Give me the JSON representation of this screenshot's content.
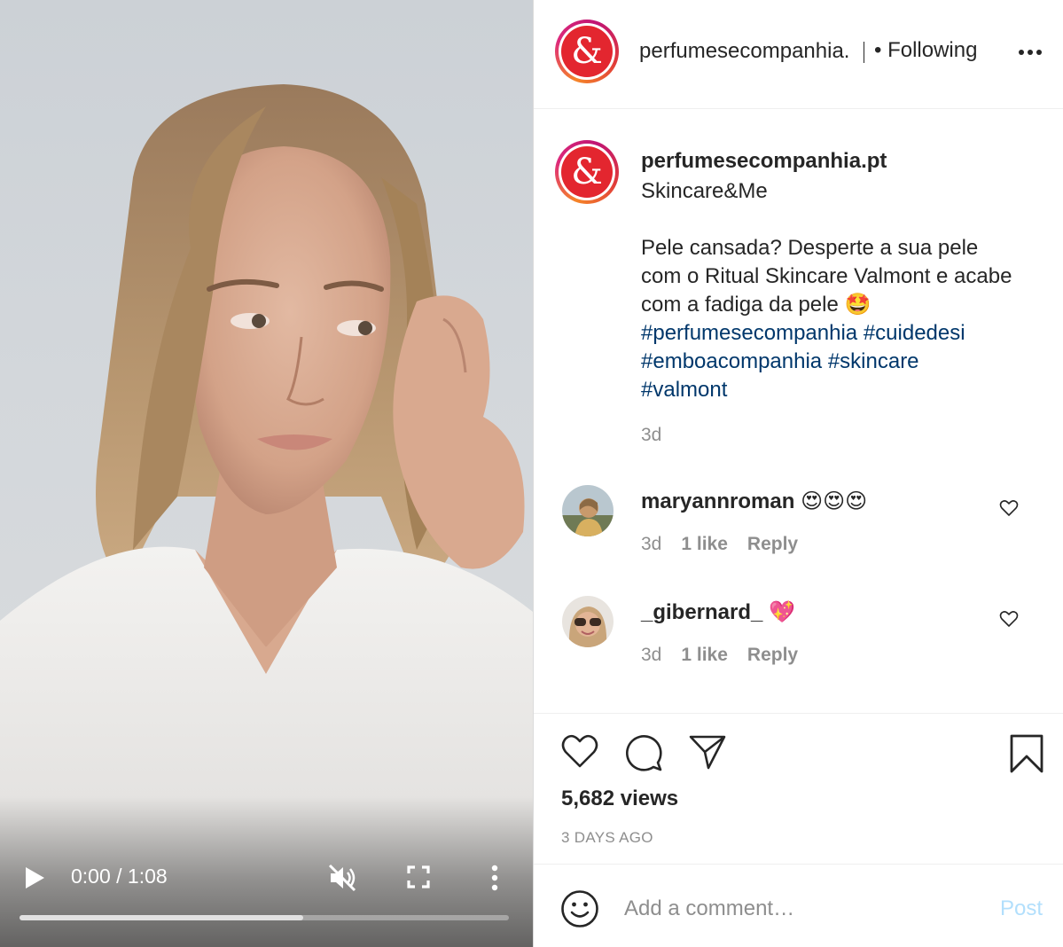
{
  "video": {
    "time": "0:00 / 1:08",
    "progress": 0.58,
    "controls": {
      "play_icon": "play-icon",
      "mute_icon": "muted-speaker-icon",
      "fullscreen_icon": "fullscreen-icon",
      "menu_icon": "more-vertical-icon"
    }
  },
  "header": {
    "username": "perfumesecompanhia.",
    "follow_status": "• Following",
    "avatar_glyph": "&",
    "more_icon": "more-horizontal-icon"
  },
  "caption": {
    "username": "perfumesecompanhia.pt",
    "line1": "Skincare&Me",
    "body": "Pele cansada? Desperte a sua pele com o Ritual Skincare Valmont e acabe com a fadiga da pele 🤩",
    "tags": [
      "#perfumesecompanhia",
      "#cuidedesi",
      "#emboacompanhia",
      "#skincare",
      "#valmont"
    ],
    "time": "3d"
  },
  "comments": [
    {
      "username": "maryannroman",
      "text": "😍😍😍",
      "time": "3d",
      "likes": "1 like",
      "reply": "Reply"
    },
    {
      "username": "_gibernard_",
      "text": "💖",
      "time": "3d",
      "likes": "1 like",
      "reply": "Reply"
    }
  ],
  "actions": {
    "like_icon": "heart-icon",
    "comment_icon": "comment-bubble-icon",
    "share_icon": "paper-plane-icon",
    "save_icon": "bookmark-icon",
    "views": "5,682 views",
    "date": "3 DAYS AGO"
  },
  "composer": {
    "placeholder": "Add a comment…",
    "post_label": "Post",
    "emoji_icon": "smiley-icon"
  },
  "colors": {
    "link": "#00376b",
    "secondary_text": "#8e8e8e",
    "post_disabled": "#b2dffc",
    "brand_red": "#e3262f"
  }
}
